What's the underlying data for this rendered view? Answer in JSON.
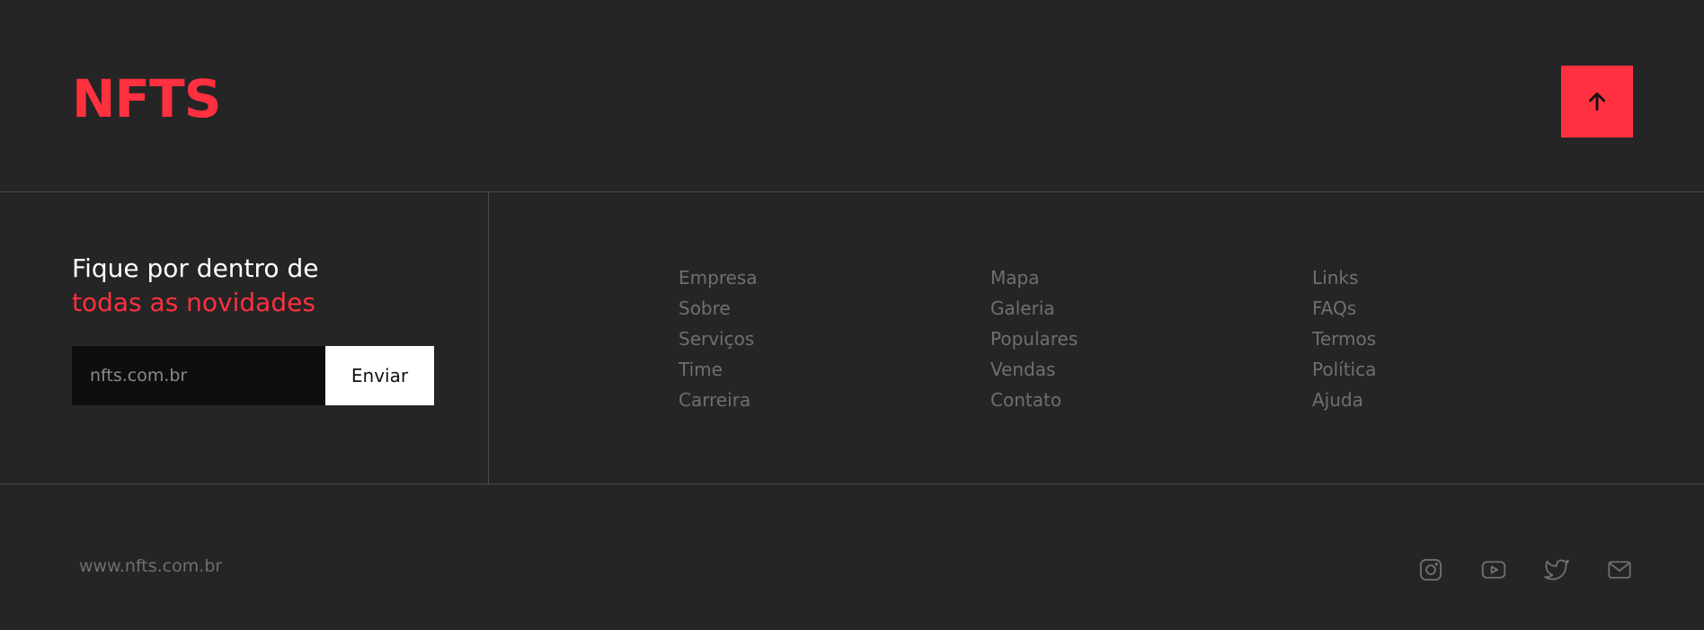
{
  "header": {
    "logo": "NFTS",
    "scroll_top_icon": "arrow-up-icon"
  },
  "newsletter": {
    "title_line1": "Fique por dentro de",
    "title_line2": "todas as novidades",
    "input_placeholder": "nfts.com.br",
    "submit_label": "Enviar"
  },
  "links": {
    "column1": [
      "Empresa",
      "Sobre",
      "Serviços",
      "Time",
      "Carreira"
    ],
    "column2": [
      "Mapa",
      "Galeria",
      "Populares",
      "Vendas",
      "Contato"
    ],
    "column3": [
      "Links",
      "FAQs",
      "Termos",
      "Política",
      "Ajuda"
    ]
  },
  "footer": {
    "site_url": "www.nfts.com.br",
    "socials": [
      "instagram-icon",
      "youtube-icon",
      "twitter-icon",
      "mail-icon"
    ]
  },
  "colors": {
    "background": "#252525",
    "accent": "#ff3040",
    "muted_text": "#6f6f6f",
    "divider": "#4c4c4c",
    "input_bg": "#0e0e0e"
  }
}
